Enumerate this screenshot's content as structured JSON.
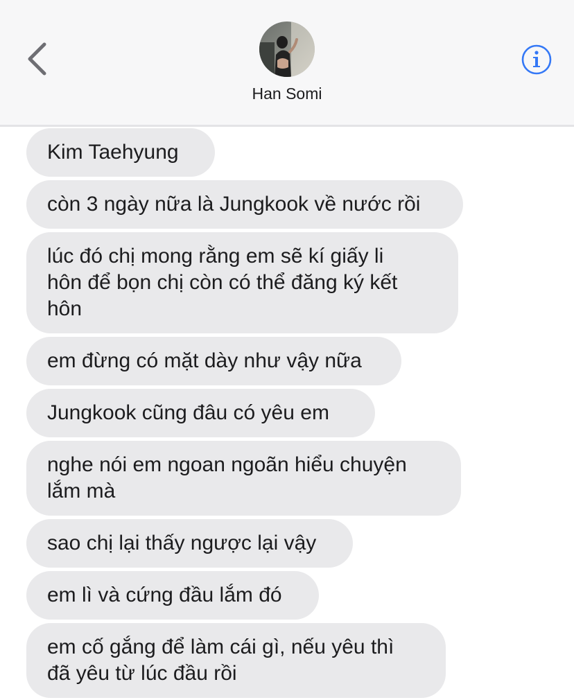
{
  "header": {
    "contact_name": "Han Somi"
  },
  "messages": [
    {
      "text": "Kim Taehyung"
    },
    {
      "text": "còn 3 ngày nữa là Jungkook về nước rồi"
    },
    {
      "text": "lúc đó chị mong rằng em sẽ kí giấy li\nhôn để bọn chị còn có thể đăng ký kết\nhôn"
    },
    {
      "text": "em đừng có mặt dày như vậy nữa"
    },
    {
      "text": "Jungkook cũng đâu có yêu em"
    },
    {
      "text": "nghe nói em ngoan ngoãn hiểu chuyện\nlắm mà"
    },
    {
      "text": "sao chị lại thấy ngược lại vậy"
    },
    {
      "text": "em lì và cứng đầu lắm đó"
    },
    {
      "text": "em cố gắng để làm cái gì, nếu yêu thì\nđã yêu từ lúc đầu rồi"
    }
  ],
  "icons": {
    "back": "chevron-left-icon",
    "info": "info-icon"
  },
  "colors": {
    "accent": "#3478f6",
    "bubble": "#e9e9eb",
    "header_bg": "#f7f7f8",
    "back_chevron": "#6e6e73"
  }
}
